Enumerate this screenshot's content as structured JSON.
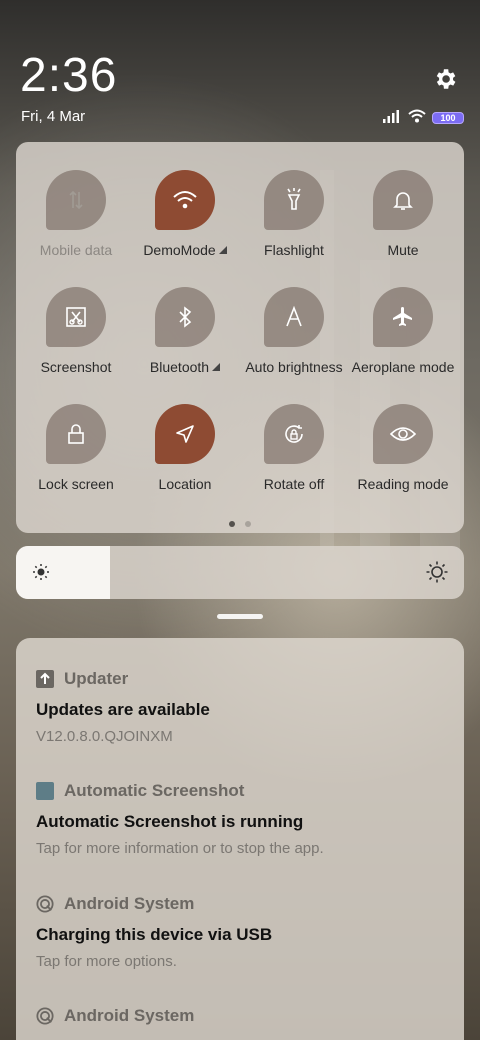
{
  "status_bar": {
    "time": "2:36",
    "date": "Fri, 4 Mar",
    "battery_level": "100",
    "settings_icon": "gear-icon",
    "signal_icon": "signal-icon",
    "wifi_icon": "wifi-icon"
  },
  "quick_settings": {
    "tiles": [
      {
        "label": "Mobile data",
        "icon": "mobile-data-icon",
        "state": "disabled"
      },
      {
        "label": "DemoMode",
        "icon": "wifi-icon",
        "state": "on",
        "expandable": true
      },
      {
        "label": "Flashlight",
        "icon": "flashlight-icon",
        "state": "off"
      },
      {
        "label": "Mute",
        "icon": "bell-icon",
        "state": "off"
      },
      {
        "label": "Screenshot",
        "icon": "screenshot-icon",
        "state": "off"
      },
      {
        "label": "Bluetooth",
        "icon": "bluetooth-icon",
        "state": "off",
        "expandable": true
      },
      {
        "label": "Auto brightness",
        "icon": "auto-brightness-icon",
        "state": "off"
      },
      {
        "label": "Aeroplane mode",
        "icon": "airplane-icon",
        "state": "off"
      },
      {
        "label": "Lock screen",
        "icon": "lock-icon",
        "state": "off"
      },
      {
        "label": "Location",
        "icon": "location-icon",
        "state": "on"
      },
      {
        "label": "Rotate off",
        "icon": "rotate-lock-icon",
        "state": "off"
      },
      {
        "label": "Reading mode",
        "icon": "eye-icon",
        "state": "off"
      }
    ],
    "page_count": 2,
    "current_page": 1
  },
  "brightness": {
    "level": 0.21
  },
  "notifications": [
    {
      "app": "Updater",
      "icon": "updater-icon",
      "title": "Updates are available",
      "body": "V12.0.8.0.QJOINXM"
    },
    {
      "app": "Automatic Screenshot",
      "icon": "app-square-icon",
      "title": "Automatic Screenshot is running",
      "body": "Tap for more information or to stop the app."
    },
    {
      "app": "Android System",
      "icon": "android-system-icon",
      "title": "Charging this device via USB",
      "body": "Tap for more options."
    },
    {
      "app": "Android System",
      "icon": "android-system-icon",
      "title": "",
      "body": ""
    }
  ],
  "colors": {
    "tile_active": "#8e4b33",
    "battery": "#7c6cf4"
  }
}
